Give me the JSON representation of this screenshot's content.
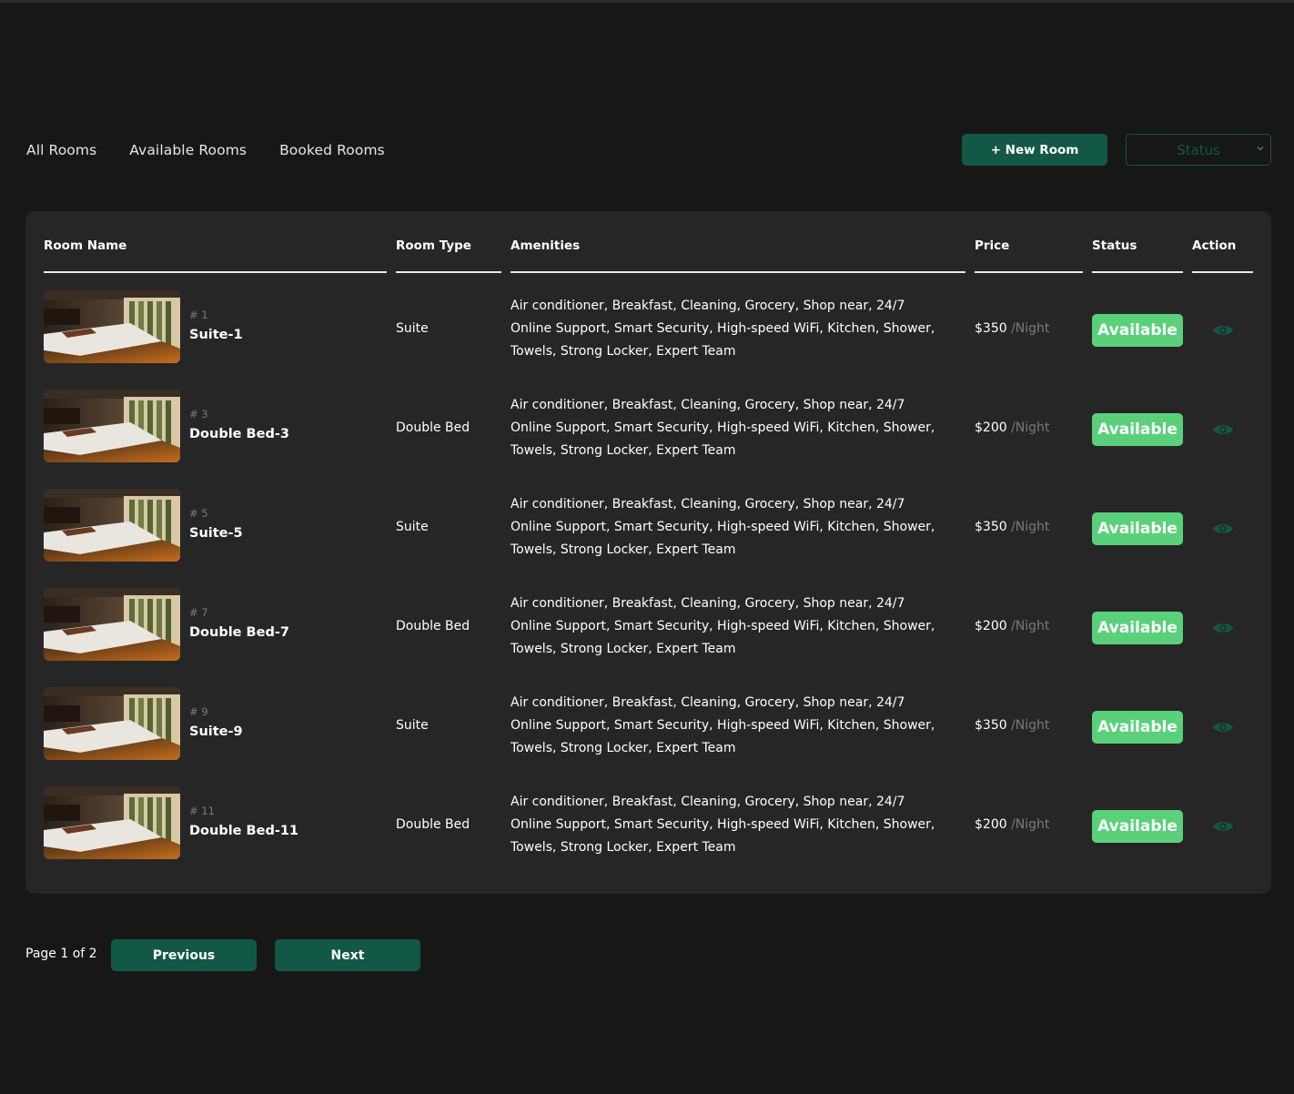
{
  "tabs": [
    {
      "label": "All Rooms"
    },
    {
      "label": "Available Rooms"
    },
    {
      "label": "Booked Rooms"
    }
  ],
  "toolbar": {
    "new_room_label": "+ New Room",
    "status_select_value": "Status"
  },
  "table": {
    "headers": {
      "room_name": "Room Name",
      "room_type": "Room Type",
      "amenities": "Amenities",
      "price": "Price",
      "status": "Status",
      "action": "Action"
    },
    "rows": [
      {
        "id": "# 1",
        "name": "Suite-1",
        "type": "Suite",
        "amenities": "Air conditioner, Breakfast, Cleaning, Grocery, Shop near, 24/7 Online Support, Smart Security, High-speed WiFi, Kitchen, Shower, Towels, Strong Locker, Expert Team",
        "price": "$350",
        "per": " /Night",
        "status": "Available"
      },
      {
        "id": "# 3",
        "name": "Double Bed-3",
        "type": "Double Bed",
        "amenities": "Air conditioner, Breakfast, Cleaning, Grocery, Shop near, 24/7 Online Support, Smart Security, High-speed WiFi, Kitchen, Shower, Towels, Strong Locker, Expert Team",
        "price": "$200",
        "per": " /Night",
        "status": "Available"
      },
      {
        "id": "# 5",
        "name": "Suite-5",
        "type": "Suite",
        "amenities": "Air conditioner, Breakfast, Cleaning, Grocery, Shop near, 24/7 Online Support, Smart Security, High-speed WiFi, Kitchen, Shower, Towels, Strong Locker, Expert Team",
        "price": "$350",
        "per": " /Night",
        "status": "Available"
      },
      {
        "id": "# 7",
        "name": "Double Bed-7",
        "type": "Double Bed",
        "amenities": "Air conditioner, Breakfast, Cleaning, Grocery, Shop near, 24/7 Online Support, Smart Security, High-speed WiFi, Kitchen, Shower, Towels, Strong Locker, Expert Team",
        "price": "$200",
        "per": " /Night",
        "status": "Available"
      },
      {
        "id": "# 9",
        "name": "Suite-9",
        "type": "Suite",
        "amenities": "Air conditioner, Breakfast, Cleaning, Grocery, Shop near, 24/7 Online Support, Smart Security, High-speed WiFi, Kitchen, Shower, Towels, Strong Locker, Expert Team",
        "price": "$350",
        "per": " /Night",
        "status": "Available"
      },
      {
        "id": "# 11",
        "name": "Double Bed-11",
        "type": "Double Bed",
        "amenities": "Air conditioner, Breakfast, Cleaning, Grocery, Shop near, 24/7 Online Support, Smart Security, High-speed WiFi, Kitchen, Shower, Towels, Strong Locker, Expert Team",
        "price": "$200",
        "per": " /Night",
        "status": "Available"
      }
    ]
  },
  "pagination": {
    "page_info": "Page 1 of 2",
    "previous_label": "Previous",
    "next_label": "Next"
  },
  "colors": {
    "background": "#171717",
    "card": "#262626",
    "accent": "#135846",
    "available": "#5ad07a",
    "muted": "#7a7a7a"
  },
  "icons": {
    "action": "eye-icon",
    "select_arrow": "chevron-down-icon",
    "room_thumbnail": "room-photo"
  }
}
